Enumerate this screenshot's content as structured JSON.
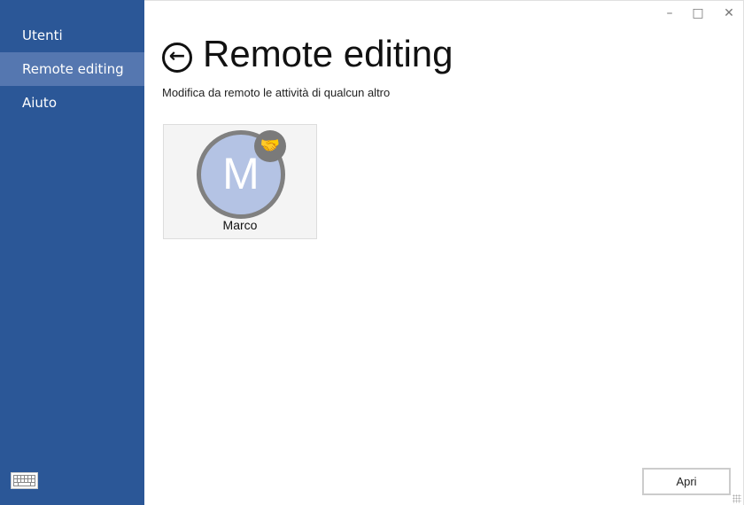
{
  "sidebar": {
    "items": [
      {
        "label": "Utenti"
      },
      {
        "label": "Remote editing",
        "selected": true
      },
      {
        "label": "Aiuto"
      }
    ],
    "keyboard_icon": "keyboard-icon",
    "color": "#2b5797"
  },
  "window": {
    "minimize": "–",
    "maximize": "□",
    "close": "✕"
  },
  "page": {
    "title": "Remote editing",
    "subtitle": "Modifica da remoto le attività di qualcun altro",
    "back_icon": "arrow-left-circle-icon"
  },
  "users": [
    {
      "name": "Marco",
      "initial": "M",
      "badge_icon": "handshake-icon"
    }
  ],
  "footer": {
    "open_label": "Apri"
  }
}
